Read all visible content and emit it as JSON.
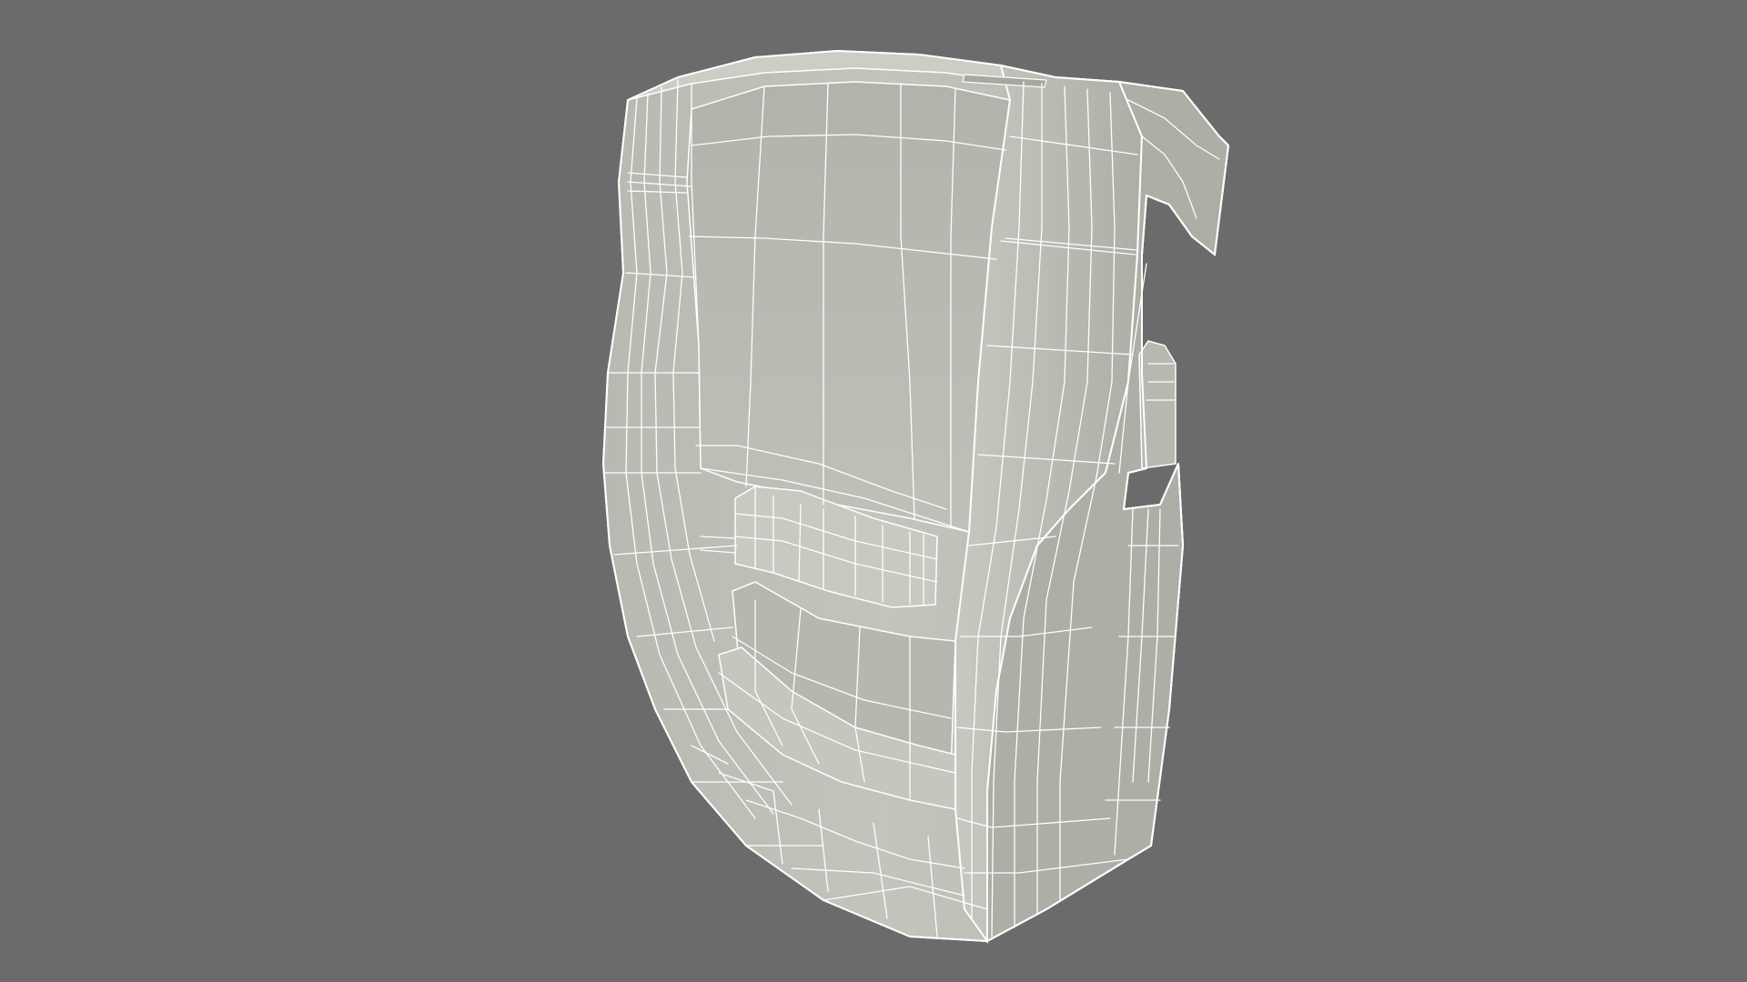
{
  "scene": {
    "background_color": "#6b6b6b",
    "model_surface_color": "#bdbcb5",
    "model_shadow_color": "#a3a29b",
    "wireframe_color": "#ffffff",
    "render_mode": "clay-wireframe",
    "subject": "printer-cradle-model"
  }
}
